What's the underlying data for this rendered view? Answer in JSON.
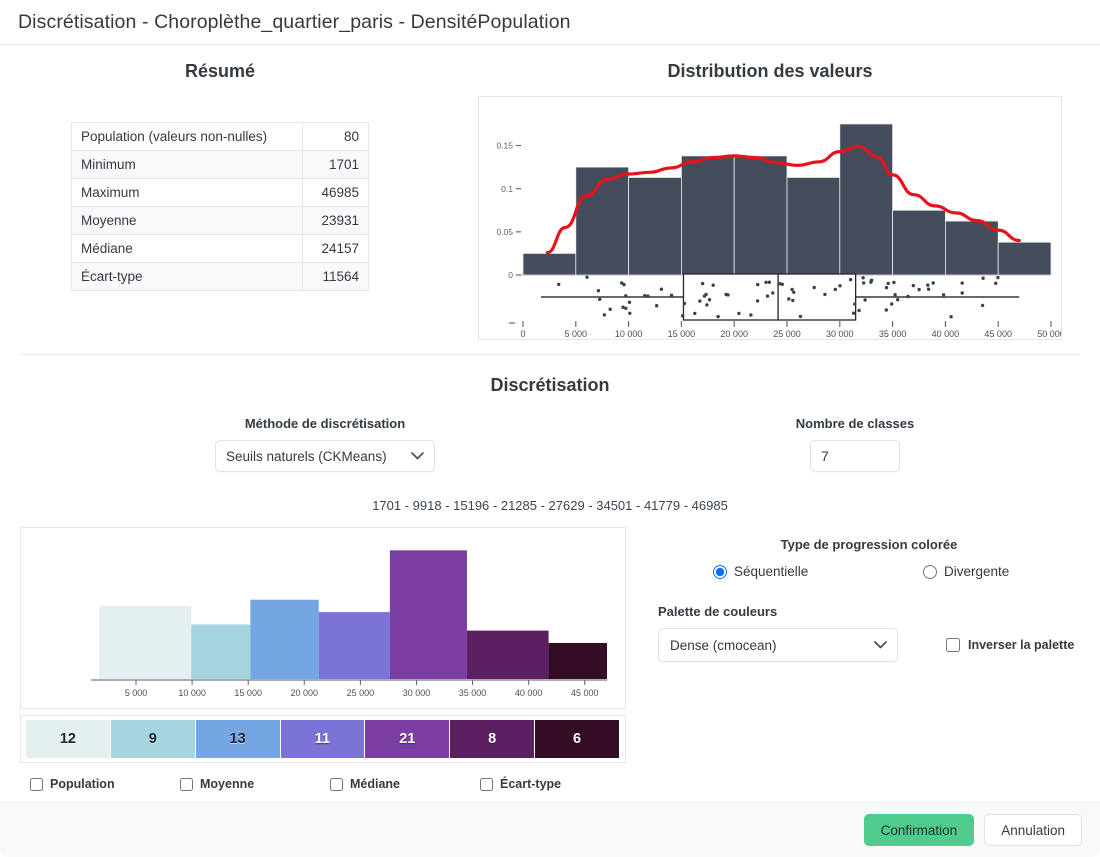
{
  "window": {
    "title": "Discrétisation  - Choroplèthe_quartier_paris  - DensitéPopulation"
  },
  "resume": {
    "heading": "Résumé",
    "rows": [
      {
        "label": "Population (valeurs non-nulles)",
        "value": "80"
      },
      {
        "label": "Minimum",
        "value": "1701"
      },
      {
        "label": "Maximum",
        "value": "46985"
      },
      {
        "label": "Moyenne",
        "value": "23931"
      },
      {
        "label": "Médiane",
        "value": "24157"
      },
      {
        "label": "Écart-type",
        "value": "11564"
      }
    ]
  },
  "distribution": {
    "heading": "Distribution des valeurs"
  },
  "discretisation": {
    "heading": "Discrétisation",
    "method_label": "Méthode de discrétisation",
    "method_value": "Seuils naturels (CKMeans)",
    "method_options": [
      "Seuils naturels (CKMeans)"
    ],
    "nb_classes_label": "Nombre de classes",
    "nb_classes_value": "7",
    "breaks_text": "1701 - 9918 - 15196 - 21285 - 27629 - 34501 - 41779 - 46985"
  },
  "palette_controls": {
    "progression_label": "Type de progression colorée",
    "sequential_label": "Séquentielle",
    "divergent_label": "Divergente",
    "selected_progression": "sequential",
    "palette_label": "Palette de couleurs",
    "palette_value": "Dense (cmocean)",
    "palette_options": [
      "Dense (cmocean)"
    ],
    "invert_label": "Inverser la palette",
    "invert_checked": false
  },
  "stat_overlays": [
    {
      "label": "Population",
      "checked": false
    },
    {
      "label": "Moyenne",
      "checked": false
    },
    {
      "label": "Médiane",
      "checked": false
    },
    {
      "label": "Écart-type",
      "checked": false
    }
  ],
  "footer": {
    "confirm_label": "Confirmation",
    "cancel_label": "Annulation"
  },
  "colors": {
    "accent_green": "#4ecb8d",
    "hist_dark": "#454c5c",
    "density_red": "#e8131a",
    "radio_blue": "#0d6efd",
    "class_colors": [
      "#e4eff0",
      "#a6d3e0",
      "#73a6e2",
      "#7b73d6",
      "#7b3fa4",
      "#5c1f62",
      "#330d26"
    ]
  },
  "chart_data": [
    {
      "id": "distribution-histogram",
      "type": "bar",
      "title": "Distribution des valeurs",
      "xlabel": "",
      "ylabel": "",
      "xlim": [
        0,
        50000
      ],
      "ylim": [
        0,
        0.19
      ],
      "x_ticks": [
        0,
        5000,
        10000,
        15000,
        20000,
        25000,
        30000,
        35000,
        40000,
        45000,
        50000
      ],
      "x_tick_labels": [
        "0",
        "5 000",
        "10 000",
        "15 000",
        "20 000",
        "25 000",
        "30 000",
        "35 000",
        "40 000",
        "45 000",
        "50 000"
      ],
      "y_ticks": [
        0,
        0.05,
        0.1,
        0.15
      ],
      "y_tick_labels": [
        "0",
        "0.05",
        "0.1",
        "0.15"
      ],
      "bin_edges": [
        0,
        5000,
        10000,
        15000,
        20000,
        25000,
        30000,
        35000,
        40000,
        45000,
        50000
      ],
      "values": [
        0.025,
        0.125,
        0.113,
        0.138,
        0.138,
        0.113,
        0.175,
        0.075,
        0.0625,
        0.038
      ],
      "grid": false,
      "legend": false,
      "density_curve": {
        "name": "Densité (KDE)",
        "color": "#e8131a",
        "x": [
          2300,
          4000,
          6000,
          8000,
          10000,
          12000,
          14000,
          16000,
          18000,
          20000,
          22000,
          24000,
          26000,
          28000,
          30000,
          31800,
          33500,
          35000,
          37000,
          39000,
          41000,
          43000,
          45000,
          47000
        ],
        "y": [
          0.026,
          0.055,
          0.092,
          0.111,
          0.117,
          0.119,
          0.124,
          0.131,
          0.136,
          0.138,
          0.136,
          0.13,
          0.127,
          0.131,
          0.143,
          0.149,
          0.137,
          0.116,
          0.093,
          0.08,
          0.072,
          0.063,
          0.052,
          0.04
        ]
      },
      "box_plot": {
        "min": 1701,
        "q1": 15196,
        "median": 24157,
        "q3": 31500,
        "max": 46985
      }
    },
    {
      "id": "classified-histogram",
      "type": "bar",
      "title": "",
      "xlabel": "",
      "ylabel": "",
      "xlim": [
        1701,
        46985
      ],
      "ylim": [
        0,
        23
      ],
      "x_ticks": [
        5000,
        10000,
        15000,
        20000,
        25000,
        30000,
        35000,
        40000,
        45000
      ],
      "x_tick_labels": [
        "5 000",
        "10 000",
        "15 000",
        "20 000",
        "25 000",
        "30 000",
        "35 000",
        "40 000",
        "45 000"
      ],
      "bin_edges": [
        1701,
        9918,
        15196,
        21285,
        27629,
        34501,
        41779,
        46985
      ],
      "categories": [
        "1701 - 9918",
        "9918 - 15196",
        "15196 - 21285",
        "21285 - 27629",
        "27629 - 34501",
        "34501 - 41779",
        "41779 - 46985"
      ],
      "values": [
        12,
        9,
        13,
        11,
        21,
        8,
        6
      ],
      "bar_colors": [
        "#e4eff0",
        "#a6d3e0",
        "#73a6e2",
        "#7b73d6",
        "#7b3fa4",
        "#5c1f62",
        "#330d26"
      ],
      "grid": false,
      "legend": false
    }
  ]
}
